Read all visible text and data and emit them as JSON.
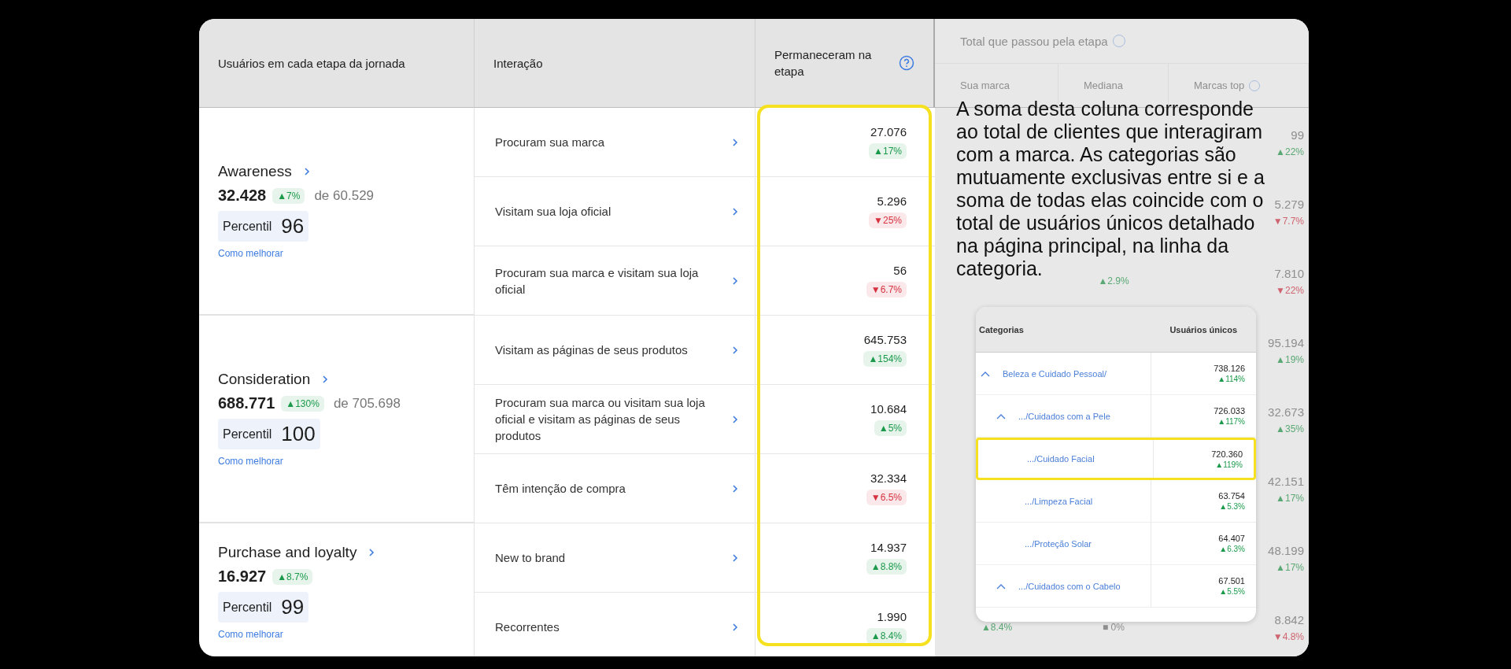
{
  "table": {
    "columns": {
      "stage": "Usuários em cada etapa da jornada",
      "interaction": "Interação",
      "remained": "Permaneceram na etapa",
      "total": {
        "title": "Total que passou pela etapa",
        "sub": [
          "Sua marca",
          "Mediana",
          "Marcas top"
        ]
      }
    },
    "groups": [
      {
        "name": "Awareness",
        "value": "32.428",
        "delta": {
          "text": "▲7%",
          "color": "#1a9a4a"
        },
        "of": "de 60.529",
        "percentile_label": "Percentil",
        "percentile": "96",
        "link": "Como melhorar",
        "rows": [
          {
            "interaction": "Procuram sua marca",
            "remained": "27.076",
            "delta": {
              "text": "▲17%",
              "color": "#1a9a4a"
            },
            "total": {
              "marcas_top": {
                "value": "99",
                "delta": {
                  "text": "▲22%",
                  "color": "#5aa874"
                }
              }
            }
          },
          {
            "interaction": "Visitam sua loja oficial",
            "remained": "5.296",
            "delta": {
              "text": "▼25%",
              "color": "#d6313f"
            },
            "total": {
              "marcas_top": {
                "value": "5.279",
                "delta": {
                  "text": "▼7.7%",
                  "color": "#cf6470"
                }
              }
            }
          },
          {
            "interaction": "Procuram sua marca e visitam sua loja oficial",
            "remained": "56",
            "delta": {
              "text": "▼6.7%",
              "color": "#d6313f"
            },
            "total": {
              "mediana": {
                "delta": {
                  "text": "▲2.9%",
                  "color": "#5aa874"
                }
              },
              "marcas_top": {
                "value": "7.810",
                "delta": {
                  "text": "▼22%",
                  "color": "#cf6470"
                }
              }
            }
          }
        ]
      },
      {
        "name": "Consideration",
        "value": "688.771",
        "delta": {
          "text": "▲130%",
          "color": "#1a9a4a"
        },
        "of": "de 705.698",
        "percentile_label": "Percentil",
        "percentile": "100",
        "link": "Como melhorar",
        "rows": [
          {
            "interaction": "Visitam as páginas de seus produtos",
            "remained": "645.753",
            "delta": {
              "text": "▲154%",
              "color": "#1a9a4a"
            },
            "total": {
              "marcas_top": {
                "value": "95.194",
                "delta": {
                  "text": "▲19%",
                  "color": "#5aa874"
                }
              }
            }
          },
          {
            "interaction": "Procuram sua marca ou visitam sua loja oficial e visitam as páginas de seus produtos",
            "remained": "10.684",
            "delta": {
              "text": "▲5%",
              "color": "#1a9a4a"
            },
            "total": {
              "marcas_top": {
                "value": "32.673",
                "delta": {
                  "text": "▲35%",
                  "color": "#5aa874"
                }
              }
            }
          },
          {
            "interaction": "Têm intenção de compra",
            "remained": "32.334",
            "delta": {
              "text": "▼6.5%",
              "color": "#d6313f"
            },
            "total": {
              "marcas_top": {
                "value": "42.151",
                "delta": {
                  "text": "▲17%",
                  "color": "#5aa874"
                }
              }
            }
          }
        ]
      },
      {
        "name": "Purchase and loyalty",
        "value": "16.927",
        "delta": {
          "text": "▲8.7%",
          "color": "#1a9a4a"
        },
        "percentile_label": "Percentil",
        "percentile": "99",
        "link": "Como melhorar",
        "rows": [
          {
            "interaction": "New to brand",
            "remained": "14.937",
            "delta": {
              "text": "▲8.8%",
              "color": "#1a9a4a"
            },
            "total": {
              "marcas_top": {
                "value": "48.199",
                "delta": {
                  "text": "▲17%",
                  "color": "#5aa874"
                }
              }
            }
          },
          {
            "interaction": "Recorrentes",
            "remained": "1.990",
            "delta": {
              "text": "▲8.4%",
              "color": "#1a9a4a"
            },
            "total": {
              "sua_marca": {
                "delta": {
                  "text": "▲8.4%",
                  "color": "#5aa874"
                }
              },
              "mediana": {
                "delta": {
                  "text": "■ 0%",
                  "color": "#8f8f8f"
                }
              },
              "marcas_top": {
                "value": "8.842",
                "delta": {
                  "text": "▼4.8%",
                  "color": "#cf6470"
                }
              }
            }
          }
        ]
      }
    ]
  },
  "callout": "A soma desta coluna corresponde ao total de clientes que interagiram com a marca. As categorias são mutuamente exclusivas entre si e a soma de todas elas coincide com o total de usuários únicos detalhado na página principal, na linha da categoria.",
  "inset": {
    "columns": [
      "Categorias",
      "Usuários únicos"
    ],
    "tree": [
      {
        "label": "Beleza e Cuidado Pessoal/",
        "value": "738.126",
        "delta": {
          "text": "▲114%",
          "color": "#1a9a4a"
        },
        "expanded": true,
        "highlighted": false,
        "children": [
          {
            "label": ".../Cuidados com a Pele",
            "value": "726.033",
            "delta": {
              "text": "▲117%",
              "color": "#1a9a4a"
            },
            "expanded": true,
            "highlighted": false,
            "children": [
              {
                "label": ".../Cuidado Facial",
                "value": "720.360",
                "delta": {
                  "text": "▲119%",
                  "color": "#1a9a4a"
                },
                "highlighted": true
              },
              {
                "label": ".../Limpeza Facial",
                "value": "63.754",
                "delta": {
                  "text": "▲5.3%",
                  "color": "#1a9a4a"
                },
                "highlighted": false
              },
              {
                "label": ".../Proteção Solar",
                "value": "64.407",
                "delta": {
                  "text": "▲6.3%",
                  "color": "#1a9a4a"
                },
                "highlighted": false
              }
            ]
          },
          {
            "label": ".../Cuidados com o Cabelo",
            "value": "67.501",
            "delta": {
              "text": "▲5.5%",
              "color": "#1a9a4a"
            },
            "expanded": true,
            "highlighted": false
          }
        ]
      }
    ]
  }
}
